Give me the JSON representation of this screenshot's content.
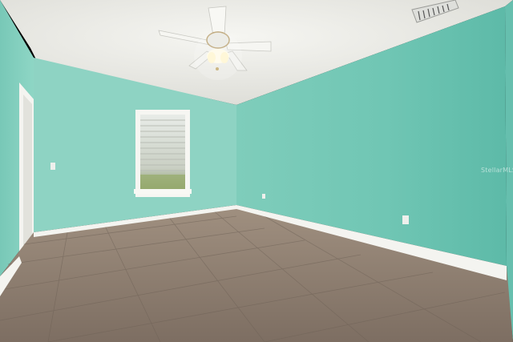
{
  "photo": {
    "subject": "empty-room-interior",
    "colors": {
      "ceiling": "#eeeeea",
      "wall_left": "#93d8c8",
      "wall_back": "#86cfbf",
      "wall_right": "#6cc4b3",
      "floor": "#8a7b6e",
      "baseboard": "#f4f4f0",
      "window_frame": "#f6f6f2"
    },
    "watermark": "StellarMLS"
  }
}
